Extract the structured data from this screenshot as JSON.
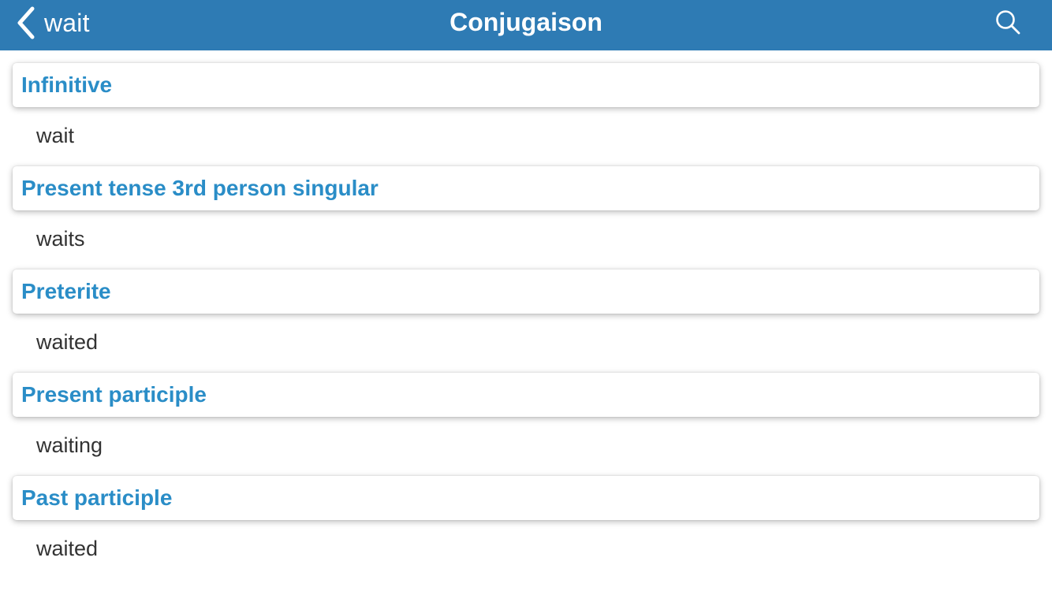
{
  "navbar": {
    "back_label": "wait",
    "title": "Conjugaison",
    "back_icon": "chevron-left-icon",
    "search_icon": "search-icon",
    "background_color": "#2e7bb4"
  },
  "sections": [
    {
      "title": "Infinitive",
      "value": "wait"
    },
    {
      "title": "Present tense 3rd person singular",
      "value": "waits"
    },
    {
      "title": "Preterite",
      "value": "waited"
    },
    {
      "title": "Present participle",
      "value": "waiting"
    },
    {
      "title": "Past participle",
      "value": "waited"
    }
  ],
  "colors": {
    "accent": "#2a8dc7",
    "text": "#333333"
  }
}
